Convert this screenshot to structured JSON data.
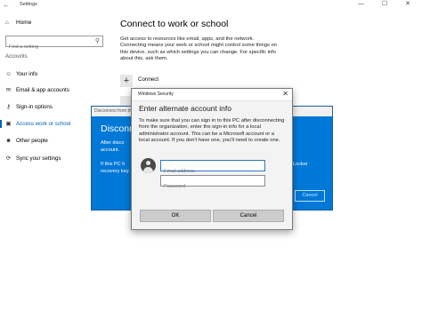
{
  "window": {
    "title": "Settings",
    "back_icon": "back-arrow-icon",
    "controls": "— ☐ ✕"
  },
  "sidebar": {
    "home": "Home",
    "search_placeholder": "Find a setting",
    "section": "Accounts",
    "items": [
      {
        "label": "Your info",
        "icon": "person-icon",
        "glyph": "☺",
        "active": false
      },
      {
        "label": "Email & app accounts",
        "icon": "mail-icon",
        "glyph": "✉",
        "active": false
      },
      {
        "label": "Sign-in options",
        "icon": "key-icon",
        "glyph": "⚷",
        "active": false
      },
      {
        "label": "Access work or school",
        "icon": "briefcase-icon",
        "glyph": "▣",
        "active": true
      },
      {
        "label": "Other people",
        "icon": "people-icon",
        "glyph": "☻",
        "active": false
      },
      {
        "label": "Sync your settings",
        "icon": "sync-icon",
        "glyph": "⟳",
        "active": false
      }
    ]
  },
  "main": {
    "heading": "Connect to work or school",
    "description": "Get access to resources like email, apps, and the network. Connecting means your work or school might control some things on this device, such as which settings you can change. For specific info about this, ask them.",
    "connect_label": "Connect"
  },
  "blue_dialog": {
    "title": "Disconnect from the organization",
    "heading": "Disconn",
    "text1": "After disco account.",
    "text2": "If this PC h recovery key",
    "side_text": "Locker",
    "cancel": "Cancel"
  },
  "security_dialog": {
    "title": "Windows Security",
    "heading": "Enter alternate account info",
    "description": "To make sure that you can sign in to this PC after disconnecting from the organization, enter the sign-in info for a local administrator account. This can be a Microsoft account or a local account. If you don't have one, you'll need to create one.",
    "email_placeholder": "Email address",
    "password_placeholder": "Password",
    "ok": "OK",
    "cancel": "Cancel"
  },
  "colors": {
    "accent": "#0078d7",
    "nav_active": "#0063b1"
  }
}
